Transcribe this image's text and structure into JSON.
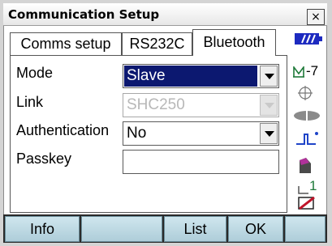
{
  "window": {
    "title": "Communication Setup",
    "close_label": "×"
  },
  "tabs": [
    {
      "label": "Comms setup"
    },
    {
      "label": "RS232C"
    },
    {
      "label": "Bluetooth"
    }
  ],
  "form": {
    "mode": {
      "label": "Mode",
      "value": "Slave"
    },
    "link": {
      "label": "Link",
      "value": "SHC250"
    },
    "authentication": {
      "label": "Authentication",
      "value": "No"
    },
    "passkey": {
      "label": "Passkey",
      "value": ""
    }
  },
  "status": {
    "tilt_value": "-7",
    "memory_value": "1",
    "colors": {
      "battery": "#1d2ac0",
      "target": "#1f9a3a",
      "bluetooth": "#0b2b8a",
      "search": "#9a1f86",
      "edit": "#c0142a"
    }
  },
  "softkeys": [
    {
      "label": "Info"
    },
    {
      "label": ""
    },
    {
      "label": "List"
    },
    {
      "label": "OK"
    },
    {
      "label": ""
    }
  ]
}
